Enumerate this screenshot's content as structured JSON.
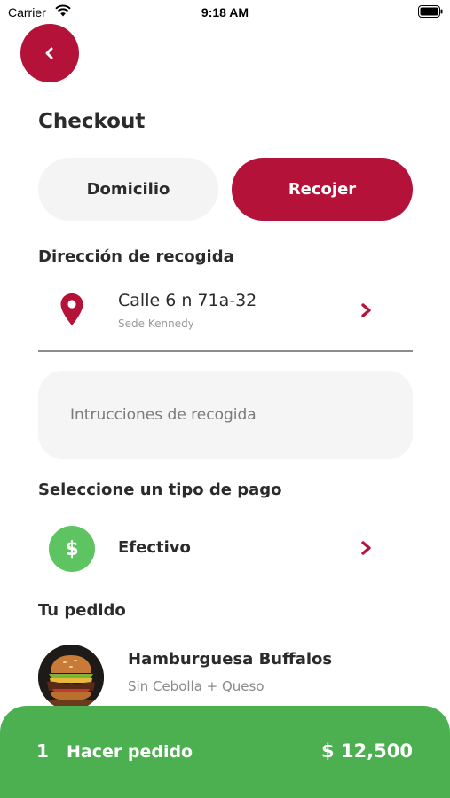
{
  "status_bar": {
    "carrier": "Carrier",
    "time": "9:18 AM"
  },
  "header": {
    "back_icon": "chevron-left-icon",
    "title": "Checkout"
  },
  "delivery_toggle": {
    "options": [
      {
        "label": "Domicilio",
        "selected": false
      },
      {
        "label": "Recojer",
        "selected": true
      }
    ]
  },
  "pickup": {
    "section_title": "Dirección de recogida",
    "address": "Calle 6 n 71a-32",
    "branch": "Sede Kennedy",
    "icon": "location-pin-icon"
  },
  "instructions": {
    "placeholder": "Intrucciones de recogida",
    "value": ""
  },
  "payment": {
    "section_title": "Seleccione un tipo de pago",
    "method": "Efectivo",
    "icon": "dollar-icon",
    "icon_glyph": "$"
  },
  "order": {
    "section_title": "Tu pedido",
    "items": [
      {
        "name": "Hamburguesa Buffalos",
        "modifiers": "Sin Cebolla + Queso"
      }
    ]
  },
  "order_bar": {
    "quantity": "1",
    "label": "Hacer pedido",
    "total": "$ 12,500"
  },
  "colors": {
    "primary": "#b5123a",
    "success": "#4caf50",
    "cash_icon": "#5ec462",
    "pill_bg": "#f4f4f4"
  }
}
